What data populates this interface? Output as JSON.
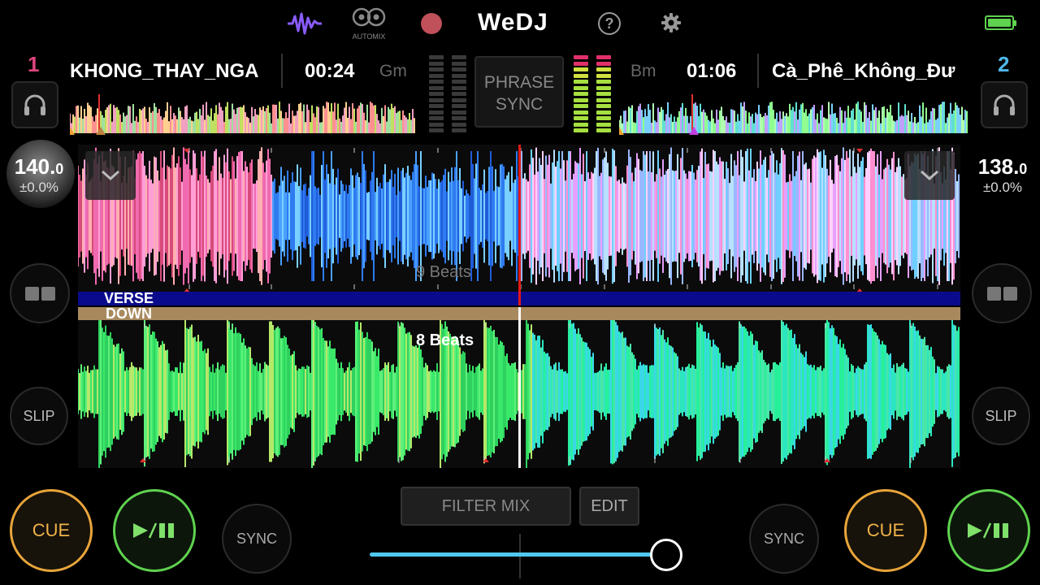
{
  "app": {
    "title": "WeDJ"
  },
  "topbar": {
    "automix_label": "AUTOMIX",
    "icons": [
      "waveform-icon",
      "automix-icon",
      "record-icon",
      "help-icon",
      "gear-icon",
      "battery-icon"
    ],
    "colors": {
      "waveform_icon": "#8a5cff",
      "record": "#c0505a",
      "battery": "#5fd24f"
    }
  },
  "phrase_sync": {
    "line1": "PHRASE",
    "line2": "SYNC"
  },
  "deck1": {
    "number": "1",
    "number_color": "#e0457f",
    "title": "KHONG_THAY_NGA",
    "time": "00:24",
    "key": "Gm",
    "bpm_int": "140.",
    "bpm_dec": "0",
    "pitch": "±0.0%",
    "beats_label": "9 Beats",
    "slip_label": "SLIP",
    "cue_label": "CUE",
    "sync_label": "SYNC",
    "phrases": [
      "VERSE",
      "DOWN"
    ],
    "phrase_colors": [
      "#0a0a8c",
      "#a8895e"
    ]
  },
  "deck2": {
    "number": "2",
    "number_color": "#4fb6e8",
    "title": "Cà_Phê_Không_Đư",
    "time": "01:06",
    "key": "Bm",
    "bpm_int": "138.",
    "bpm_dec": "0",
    "pitch": "±0.0%",
    "beats_label": "8 Beats",
    "slip_label": "SLIP",
    "cue_label": "CUE",
    "sync_label": "SYNC"
  },
  "mixer": {
    "filter_mix_label": "FILTER MIX",
    "edit_label": "EDIT",
    "crossfader_position": 0.95,
    "crossfader_color": "#4fc8f0"
  }
}
